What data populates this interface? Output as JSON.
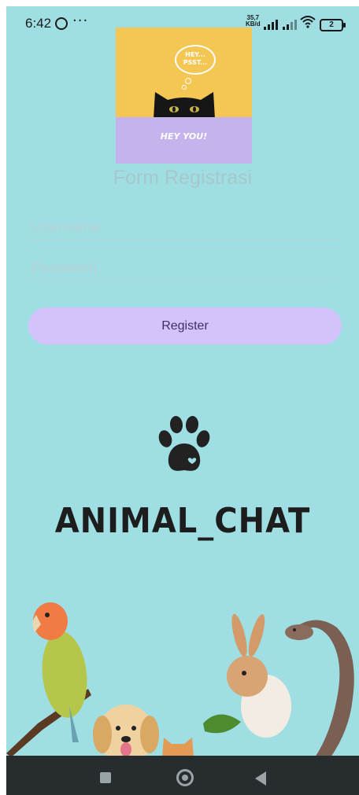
{
  "status_bar": {
    "time": "6:42",
    "more": "···",
    "speed_value": "35,7",
    "speed_unit": "KB/d",
    "battery": "2",
    "icons": [
      "whatsapp-icon",
      "signal-icon",
      "signal-icon",
      "wifi-icon",
      "battery-icon"
    ]
  },
  "banner": {
    "bubble_text": "HEY...\nPSST...",
    "caption": "HEY YOU!"
  },
  "form": {
    "title": "Form Registrasi",
    "username_placeholder": "Username",
    "password_placeholder": "Password",
    "register_label": "Register"
  },
  "logo": {
    "icon": "paw-heart-icon",
    "name": "ANIMAL_CHAT"
  },
  "nav": {
    "icons": [
      "recent-apps-icon",
      "home-icon",
      "back-icon"
    ]
  },
  "colors": {
    "background": "#9fdfe4",
    "button": "#d3c3fa",
    "banner_top": "#f4c653",
    "banner_bottom": "#c4b3ec",
    "navbar": "#272d2e"
  }
}
